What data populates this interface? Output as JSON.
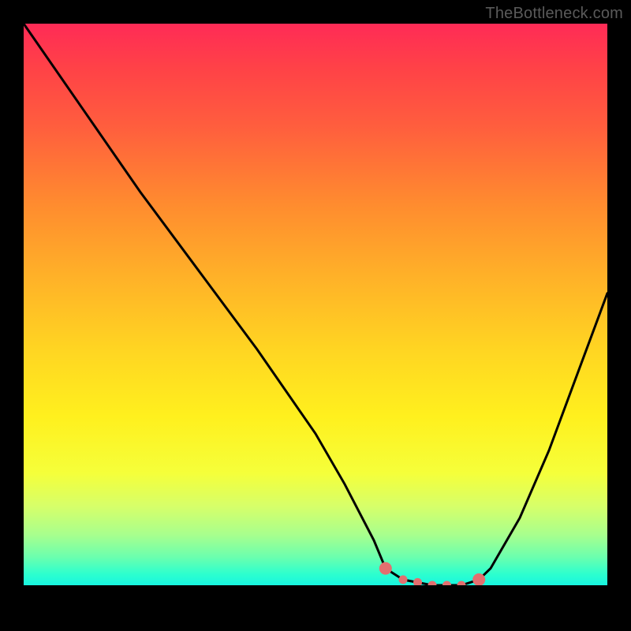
{
  "watermark": "TheBottleneck.com",
  "chart_data": {
    "type": "line",
    "title": "",
    "xlabel": "",
    "ylabel": "",
    "xlim": [
      0,
      100
    ],
    "ylim": [
      0,
      100
    ],
    "grid": false,
    "series": [
      {
        "name": "curve",
        "x": [
          0,
          10,
          20,
          30,
          40,
          50,
          55,
          60,
          62,
          65,
          70,
          75,
          78,
          80,
          85,
          90,
          95,
          100
        ],
        "values": [
          100,
          85,
          70,
          56,
          42,
          27,
          18,
          8,
          3,
          1,
          0,
          0,
          1,
          3,
          12,
          24,
          38,
          52
        ],
        "color": "#000000"
      }
    ],
    "markers": {
      "color": "#e36f6f",
      "points": [
        {
          "x": 62,
          "y": 3
        },
        {
          "x": 65,
          "y": 1
        },
        {
          "x": 67.5,
          "y": 0.5
        },
        {
          "x": 70,
          "y": 0
        },
        {
          "x": 72.5,
          "y": 0
        },
        {
          "x": 75,
          "y": 0
        },
        {
          "x": 78,
          "y": 1
        }
      ]
    },
    "background_gradient": {
      "top": "#ff2b56",
      "mid": "#ffe720",
      "bottom": "#18f5e0"
    }
  }
}
